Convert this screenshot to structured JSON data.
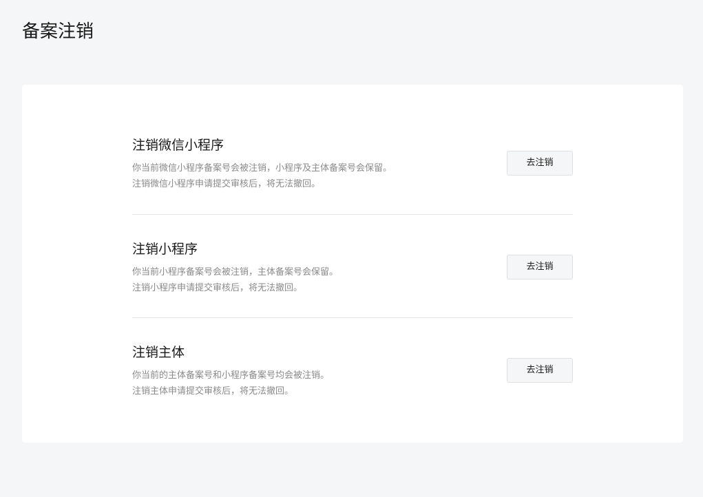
{
  "page": {
    "title": "备案注销"
  },
  "sections": [
    {
      "title": "注销微信小程序",
      "lines": [
        "你当前微信小程序备案号会被注销，小程序及主体备案号会保留。",
        "注销微信小程序申请提交审核后，将无法撤回。"
      ],
      "button_label": "去注销"
    },
    {
      "title": "注销小程序",
      "lines": [
        "你当前小程序备案号会被注销，主体备案号会保留。",
        "注销小程序申请提交审核后，将无法撤回。"
      ],
      "button_label": "去注销"
    },
    {
      "title": "注销主体",
      "lines": [
        "你当前的主体备案号和小程序备案号均会被注销。",
        "注销主体申请提交审核后，将无法撤回。"
      ],
      "button_label": "去注销"
    }
  ]
}
